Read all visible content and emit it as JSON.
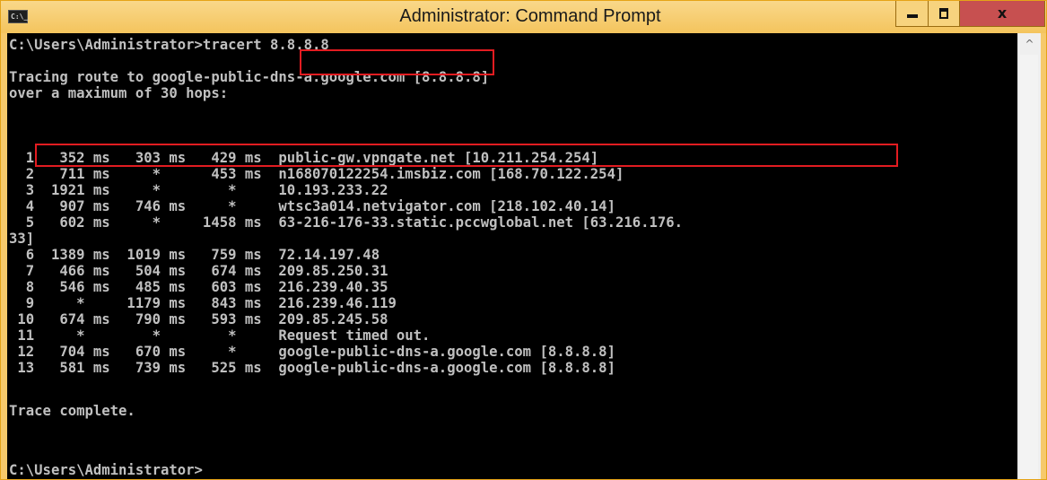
{
  "window": {
    "title": "Administrator: Command Prompt",
    "app_icon_text": "C:\\_",
    "controls": [
      "minimize",
      "maximize",
      "close"
    ],
    "close_symbol": "x"
  },
  "console": {
    "lines": [
      "C:\\Users\\Administrator>tracert 8.8.8.8",
      "",
      "Tracing route to google-public-dns-a.google.com [8.8.8.8]",
      "over a maximum of 30 hops:",
      "",
      "  1   352 ms   303 ms   429 ms  public-gw.vpngate.net [10.211.254.254]",
      "  2   711 ms     *      453 ms  n168070122254.imsbiz.com [168.70.122.254]",
      "  3  1921 ms     *        *     10.193.233.22",
      "  4   907 ms   746 ms     *     wtsc3a014.netvigator.com [218.102.40.14]",
      "  5   602 ms     *     1458 ms  63-216-176-33.static.pccwglobal.net [63.216.176.",
      "33]",
      "  6  1389 ms  1019 ms   759 ms  72.14.197.48",
      "  7   466 ms   504 ms   674 ms  209.85.250.31",
      "  8   546 ms   485 ms   603 ms  216.239.40.35",
      "  9     *     1179 ms   843 ms  216.239.46.119",
      " 10   674 ms   790 ms   593 ms  209.85.245.58",
      " 11     *        *        *     Request timed out.",
      " 12   704 ms   670 ms     *     google-public-dns-a.google.com [8.8.8.8]",
      " 13   581 ms   739 ms   525 ms  google-public-dns-a.google.com [8.8.8.8]",
      "",
      "Trace complete.",
      "",
      "C:\\Users\\Administrator>"
    ]
  },
  "scrollbar": {
    "up_arrow": "^"
  },
  "colors": {
    "console_bg": "#000000",
    "console_text": "#c0c0c0",
    "title_bar": "#f6c96b",
    "close_button": "#c75050",
    "highlight": "#e21c21"
  }
}
